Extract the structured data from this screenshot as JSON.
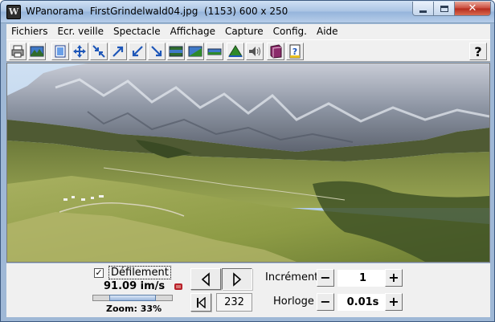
{
  "window": {
    "app_name": "WPanorama",
    "file_name": "FirstGrindelwald04.jpg",
    "image_info": "(1153) 600 x 250",
    "title": "WPanorama  FirstGrindelwald04.jpg  (1153) 600 x 250",
    "icon_letter": "W"
  },
  "menu": [
    "Fichiers",
    "Ecr. veille",
    "Spectacle",
    "Affichage",
    "Capture",
    "Config.",
    "Aide"
  ],
  "toolbar": {
    "icons": [
      "print-icon",
      "landscape-open-icon",
      "fit-window-icon",
      "fullscreen-expand-icon",
      "shrink-icon",
      "arrow-up-right-icon",
      "arrow-down-left-icon",
      "arrow-down-right-icon",
      "panorama-bar-icon",
      "panorama-gradient-icon",
      "panorama-strip-icon",
      "mountain-icon",
      "speaker-icon",
      "book-icon",
      "help-page-icon"
    ],
    "help_label": "?"
  },
  "controls": {
    "scroll_checkbox_checked": true,
    "scroll_checkbox_mark": "✓",
    "scroll_label": "Défilement",
    "speed": "91.09 im/s",
    "zoom_label": "Zoom: 33%",
    "zoom_percent": 33,
    "frame_counter": "232",
    "increment_label": "Incrément",
    "increment_value": "1",
    "clock_label": "Horloge",
    "clock_value": "0.01s",
    "minus": "−",
    "plus": "+"
  },
  "colors": {
    "title_bar": "#a9c3e3",
    "close_button": "#c9483a",
    "panel": "#f0f0f0",
    "sky": "#9dbfe6",
    "grass": "#8a9e48"
  }
}
